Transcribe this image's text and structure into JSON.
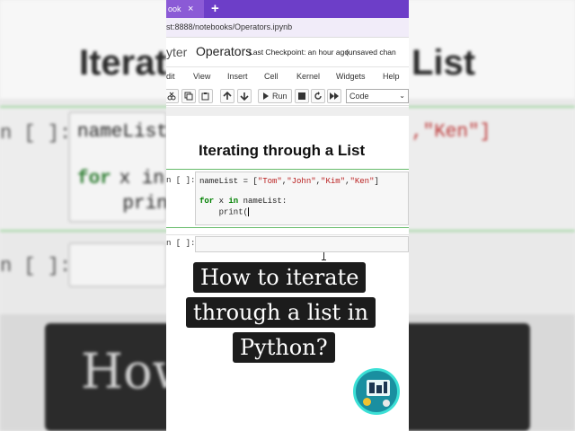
{
  "background": {
    "title_left": "Iterate",
    "title_right": "List",
    "prompt_1": "n [ ]:",
    "prompt_2": "n [ ]:",
    "code_line_1": "nameList",
    "code_line_1_right": ",\"Ken\"]",
    "code_line_2_kw": "for",
    "code_line_2": " x in",
    "code_line_3": "    prin",
    "box_text": "How          ate"
  },
  "browser": {
    "tab_label": "ook",
    "tab_close": "×",
    "new_tab": "+",
    "url": "st:8888/notebooks/Operators.ipynb"
  },
  "jupyter": {
    "logo_text": "yter",
    "notebook_name": "Operators",
    "checkpoint": "Last Checkpoint: an hour ago",
    "unsaved": "(unsaved chan"
  },
  "menu": {
    "items": [
      "dit",
      "View",
      "Insert",
      "Cell",
      "Kernel",
      "Widgets",
      "Help"
    ]
  },
  "toolbar": {
    "run_label": "Run",
    "cell_type": "Code"
  },
  "notebook": {
    "heading": "Iterating through a List",
    "cell1_prompt": "n [ ]:",
    "cell2_prompt": "n [ ]:",
    "code": {
      "line1_var": "nameList = [",
      "s1": "\"Tom\"",
      "s2": "\"John\"",
      "s3": "\"Kim\"",
      "s4": "\"Ken\"",
      "comma": ",",
      "close": "]",
      "line2_kw1": "for",
      "line2_mid": " x ",
      "line2_kw2": "in",
      "line2_rest": " nameList:",
      "line3": "    print("
    }
  },
  "overlay": {
    "caption_lines": [
      "How to iterate",
      "through a list in",
      "Python?"
    ],
    "logo": "channel-logo"
  },
  "colors": {
    "tab_bar": "#6d3ec8",
    "active_cell_border": "#66bb6a",
    "keyword": "#008000",
    "string": "#ba2121",
    "logo_ring": "#3ce0d6"
  }
}
